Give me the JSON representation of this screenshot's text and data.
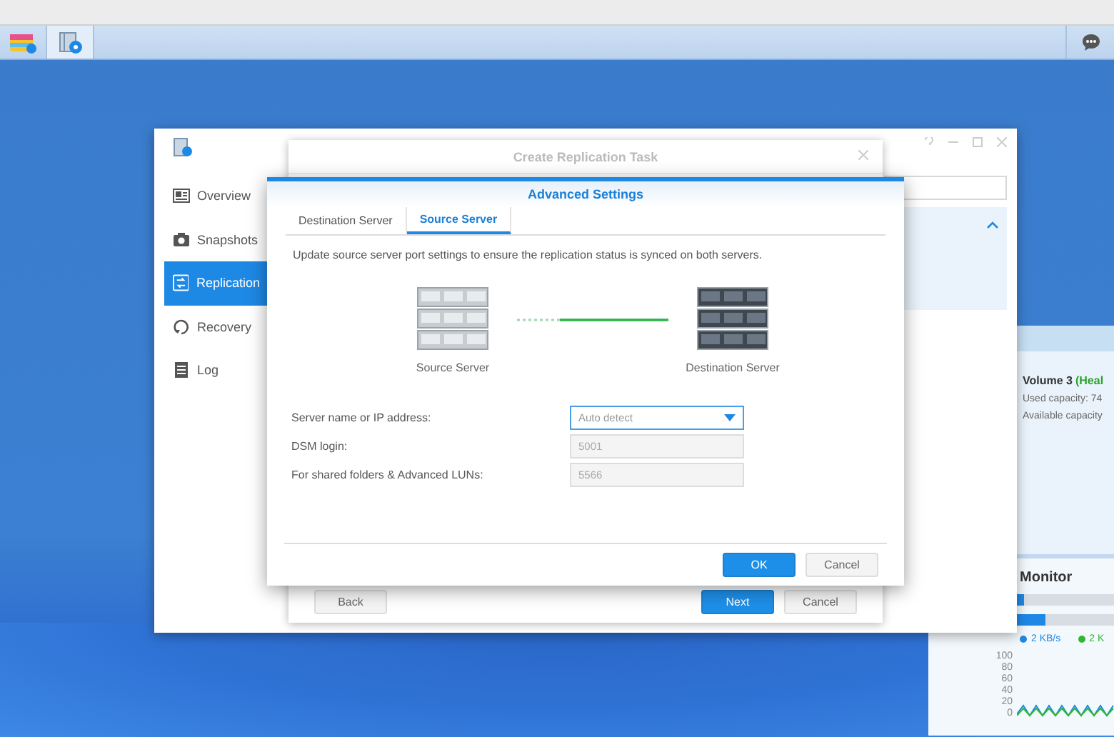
{
  "taskbar": {
    "apps": [
      {
        "selected": false
      },
      {
        "selected": true
      }
    ]
  },
  "widgets": {
    "volume": {
      "name": "Volume 3",
      "status": "(Heal",
      "used": "Used capacity: 74",
      "available": "Available capacity"
    },
    "monitor": {
      "title": "Monitor",
      "bars": [
        {
          "level": 0.06
        },
        {
          "level": 0.25
        }
      ],
      "legend": [
        {
          "text": "2 KB/s",
          "color": "#1e88e5"
        },
        {
          "text": "2 K",
          "color": "#2eb82e"
        }
      ],
      "axis_labels": [
        "100",
        "80",
        "60",
        "40",
        "20",
        "0"
      ]
    }
  },
  "main_window": {
    "sidebar": [
      {
        "label": "Overview",
        "kind": "overview",
        "selected": false
      },
      {
        "label": "Snapshots",
        "kind": "snapshots",
        "selected": false
      },
      {
        "label": "Replication",
        "kind": "replication",
        "selected": true
      },
      {
        "label": "Recovery",
        "kind": "recovery",
        "selected": false
      },
      {
        "label": "Log",
        "kind": "log",
        "selected": false
      }
    ]
  },
  "task_dialog": {
    "title": "Create Replication Task",
    "buttons": [
      {
        "label": "Back",
        "kind": "secondary"
      },
      {
        "label": "Next",
        "kind": "primary"
      },
      {
        "label": "Cancel",
        "kind": "secondary"
      }
    ]
  },
  "advanced_dialog": {
    "title": "Advanced Settings",
    "tabs": [
      {
        "label": "Destination Server",
        "selected": false
      },
      {
        "label": "Source Server",
        "selected": true
      }
    ],
    "description": "Update source server port settings to ensure the replication status is synced on both servers.",
    "servers": [
      {
        "label": "Source Server",
        "kind": "source"
      },
      {
        "label": "Destination Server",
        "kind": "destination"
      }
    ],
    "fields": [
      {
        "label": "Server name or IP address:",
        "kind": "dropdown",
        "value": "Auto detect",
        "disabled": false
      },
      {
        "label": "DSM login:",
        "kind": "text",
        "value": "5001",
        "disabled": true
      },
      {
        "label": "For shared folders & Advanced LUNs:",
        "kind": "text",
        "value": "5566",
        "disabled": true
      }
    ],
    "buttons": [
      {
        "label": "OK",
        "kind": "primary"
      },
      {
        "label": "Cancel",
        "kind": "secondary"
      }
    ]
  }
}
